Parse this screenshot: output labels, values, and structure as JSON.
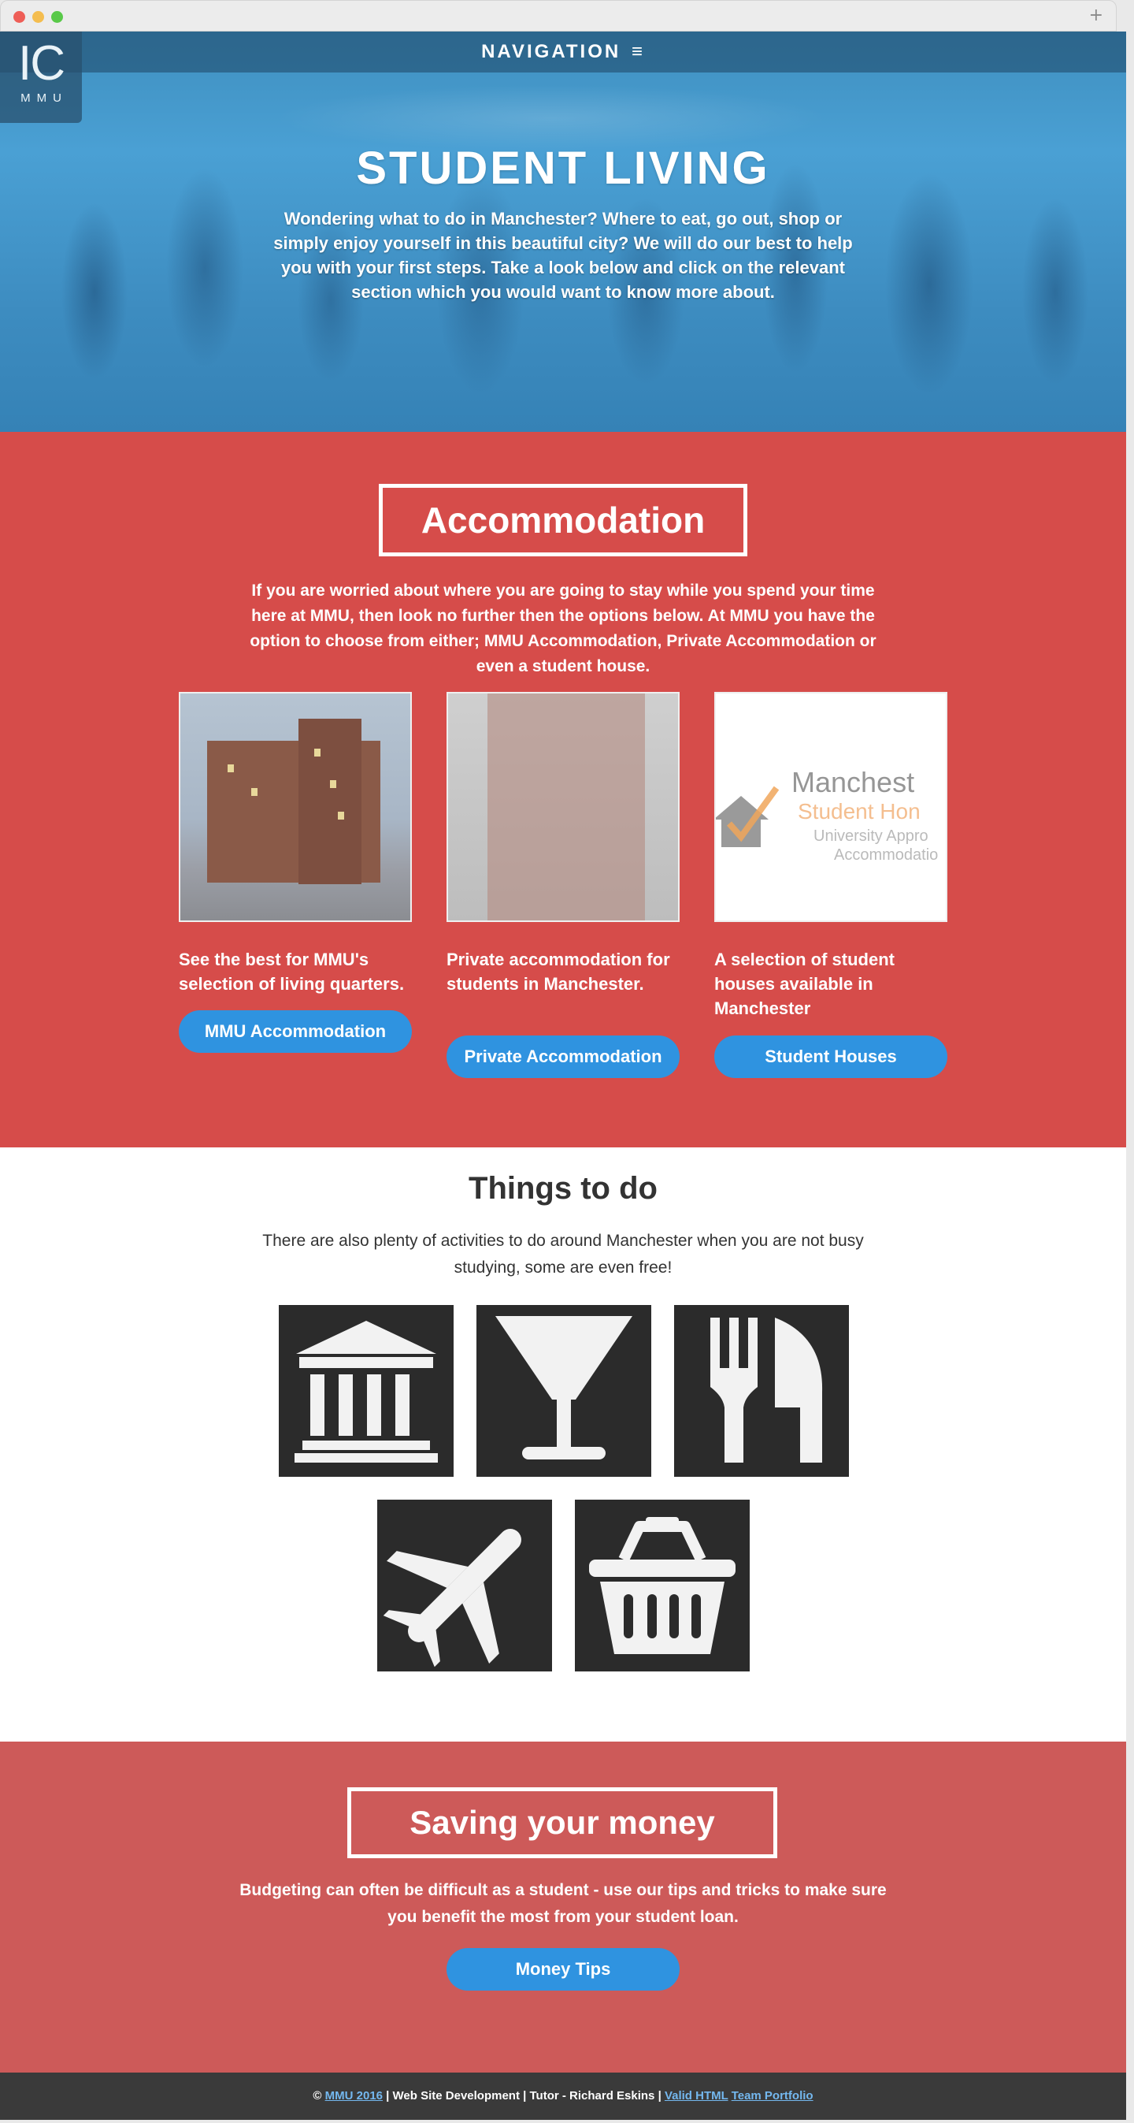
{
  "nav": {
    "label": "NAVIGATION",
    "menu_icon": "hamburger-icon"
  },
  "logo": {
    "letters": "IC",
    "sub": "MMU"
  },
  "hero": {
    "title": "STUDENT LIVING",
    "text": "Wondering what to do in Manchester? Where to eat, go out, shop or simply enjoy yourself in this beautiful city? We will do our best to help you with your first steps. Take a look below and click on the relevant section which you would want to know more about."
  },
  "accommodation": {
    "title": "Accommodation",
    "text": "If you are worried about where you are going to stay while you spend your time here at MMU, then look no further then the options below. At MMU you have the option to choose from either; MMU Accommodation, Private Accommodation or even a student house.",
    "cards": [
      {
        "desc": "See the best for MMU's selection of living quarters.",
        "button": "MMU Accommodation"
      },
      {
        "desc": "Private accommodation for students in Manchester.",
        "button": "Private Accommodation"
      },
      {
        "desc": "A selection of student houses available in Manchester",
        "button": "Student Houses"
      }
    ],
    "card3_image_text": {
      "line1": "Manchest",
      "line2": "Student Hon",
      "line3": "University Appro",
      "line4": "Accommodatio"
    }
  },
  "things": {
    "title": "Things to do",
    "text": "There are also plenty of activities to do around Manchester when you are not busy studying, some are even free!",
    "icons": [
      "museum-icon",
      "cocktail-glass-icon",
      "fork-knife-icon",
      "airplane-icon",
      "shopping-basket-icon"
    ]
  },
  "saving": {
    "title": "Saving your money",
    "text": "Budgeting can often be difficult as a student - use our tips and tricks to make sure you benefit the most from your student loan.",
    "button": "Money Tips"
  },
  "footer": {
    "copy": "©",
    "link1": "MMU 2016",
    "middle": " | Web Site Development | Tutor - Richard Eskins | ",
    "link2": "Valid HTML",
    "link3": "Team Portfolio"
  },
  "colors": {
    "hero": "#4aa0d4",
    "accommodation_bg": "#d64c4a",
    "saving_bg": "#cd5a59",
    "button": "#2f93e0",
    "footer_bg": "#3a3a3a",
    "icon_tile": "#2b2b2b"
  }
}
